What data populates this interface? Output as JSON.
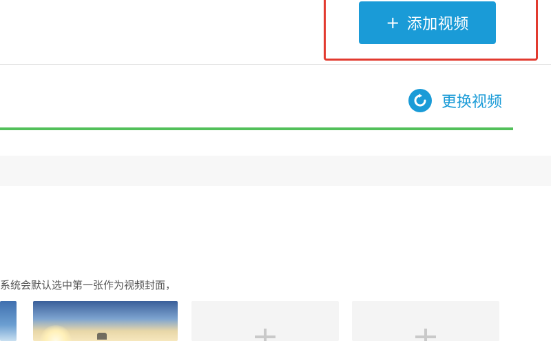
{
  "header": {
    "add_button": {
      "icon": "plus-icon",
      "plus_glyph": "+",
      "label": "添加视频",
      "color": "#1a9bd7"
    },
    "highlight_color": "#e23a2f"
  },
  "upload": {
    "replace_label": "更换视频",
    "replace_icon": "refresh-icon",
    "progress_fraction": 1.0,
    "progress_color": "#52c05a"
  },
  "cover": {
    "hint_text": "系统会默认选中第一张作为视频封面，",
    "thumbnails": [
      {
        "type": "image"
      },
      {
        "type": "image"
      },
      {
        "type": "empty",
        "icon": "plus-icon"
      },
      {
        "type": "empty",
        "icon": "plus-icon"
      }
    ]
  }
}
